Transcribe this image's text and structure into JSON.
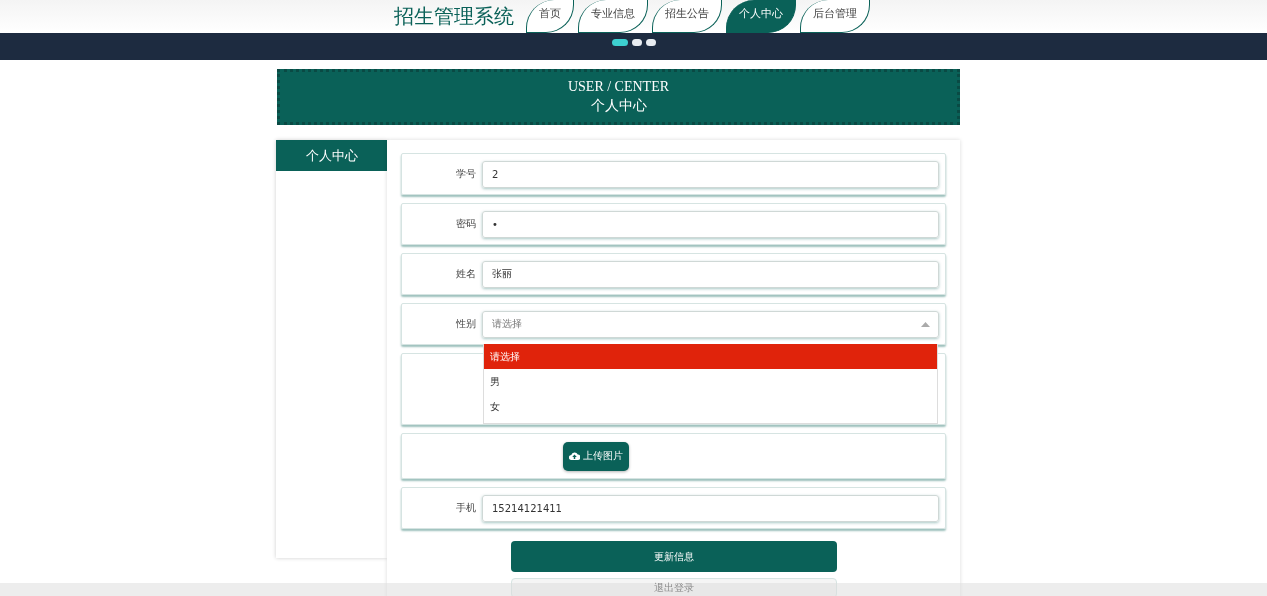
{
  "site_title": "招生管理系统",
  "nav_tabs": [
    {
      "label": "首页",
      "selected": false
    },
    {
      "label": "专业信息",
      "selected": false
    },
    {
      "label": "招生公告",
      "selected": false
    },
    {
      "label": "个人中心",
      "selected": true
    },
    {
      "label": "后台管理",
      "selected": false
    }
  ],
  "carousel_dots": [
    {
      "selected": true
    },
    {
      "selected": false
    },
    {
      "selected": false
    }
  ],
  "page_banner": {
    "title_en": "USER / CENTER",
    "title": "个人中心"
  },
  "sidebar": {
    "items": [
      {
        "label": "个人中心",
        "selected": true
      }
    ]
  },
  "form": {
    "fields": [
      {
        "kind": "input",
        "label": "学号",
        "value": "2"
      },
      {
        "kind": "input",
        "label": "密码",
        "value": "•"
      },
      {
        "kind": "input",
        "label": "姓名",
        "value": "张丽"
      },
      {
        "kind": "select",
        "label": "性别",
        "placeholder": "请选择",
        "expanded": true,
        "options": [
          {
            "label": "请选择",
            "selected": true
          },
          {
            "label": "男",
            "selected": false
          },
          {
            "label": "女",
            "selected": false
          }
        ]
      },
      {
        "kind": "blank"
      },
      {
        "kind": "upload",
        "button": "上传图片"
      },
      {
        "kind": "input",
        "label": "手机",
        "value": "15214121411"
      }
    ],
    "buttons": [
      "更新信息",
      "退出登录"
    ]
  }
}
